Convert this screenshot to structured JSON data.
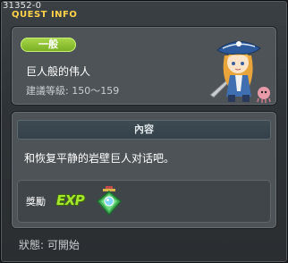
{
  "window": {
    "id": "31352-0",
    "title": "QUEST INFO"
  },
  "quest": {
    "category_badge": "一般",
    "name": "巨人般的伟人",
    "level_requirement": "建議等級: 150～159"
  },
  "content": {
    "header": "內容",
    "text": "和恢复平静的岩壁巨人对话吧。"
  },
  "reward": {
    "label": "獎勵",
    "exp_icon_text": "EXP",
    "item_icon": "gem-amulet-icon"
  },
  "status": {
    "text": "狀態: 可開始"
  },
  "colors": {
    "title": "#ffd24a",
    "badge": "#8cc034",
    "exp": "#a6e62e"
  }
}
